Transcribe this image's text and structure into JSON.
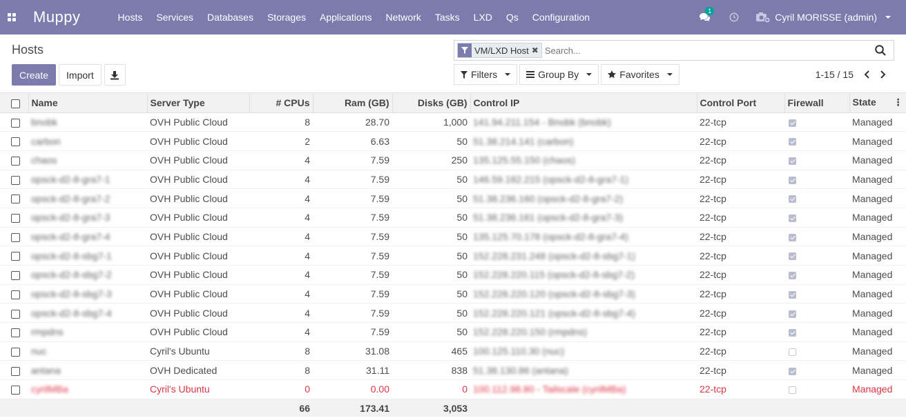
{
  "navbar": {
    "brand": "Muppy",
    "menu": [
      "Hosts",
      "Services",
      "Databases",
      "Storages",
      "Applications",
      "Network",
      "Tasks",
      "LXD",
      "Qs",
      "Configuration"
    ],
    "chat_badge": "1",
    "user": "Cyril MORISSE (admin)"
  },
  "page": {
    "title": "Hosts",
    "create_label": "Create",
    "import_label": "Import"
  },
  "search": {
    "facet": "VM/LXD Host",
    "placeholder": "Search..."
  },
  "filters": {
    "filters_label": "Filters",
    "groupby_label": "Group By",
    "favorites_label": "Favorites"
  },
  "pager": {
    "value": "1-15 / 15"
  },
  "columns": {
    "name": "Name",
    "server_type": "Server Type",
    "cpus": "# CPUs",
    "ram": "Ram (GB)",
    "disks": "Disks (GB)",
    "control_ip": "Control IP",
    "control_port": "Control Port",
    "firewall": "Firewall",
    "state": "State"
  },
  "rows": [
    {
      "name": "bnobk",
      "server_type": "OVH Public Cloud",
      "cpus": "8",
      "ram": "28.70",
      "disks": "1,000",
      "control_ip": "141.94.211.154 - Bnobk (bnobk)",
      "port": "22-tcp",
      "firewall": true,
      "state": "Managed"
    },
    {
      "name": "carbon",
      "server_type": "OVH Public Cloud",
      "cpus": "2",
      "ram": "6.63",
      "disks": "50",
      "control_ip": "51.38.214.141 (carbon)",
      "port": "22-tcp",
      "firewall": true,
      "state": "Managed"
    },
    {
      "name": "chaos",
      "server_type": "OVH Public Cloud",
      "cpus": "4",
      "ram": "7.59",
      "disks": "250",
      "control_ip": "135.125.55.150 (chaos)",
      "port": "22-tcp",
      "firewall": true,
      "state": "Managed"
    },
    {
      "name": "opsck-d2-8-gra7-1",
      "server_type": "OVH Public Cloud",
      "cpus": "4",
      "ram": "7.59",
      "disks": "50",
      "control_ip": "146.59.182.215 (opsck-d2-8-gra7-1)",
      "port": "22-tcp",
      "firewall": true,
      "state": "Managed"
    },
    {
      "name": "opsck-d2-8-gra7-2",
      "server_type": "OVH Public Cloud",
      "cpus": "4",
      "ram": "7.59",
      "disks": "50",
      "control_ip": "51.38.236.160 (opsck-d2-8-gra7-2)",
      "port": "22-tcp",
      "firewall": true,
      "state": "Managed"
    },
    {
      "name": "opsck-d2-8-gra7-3",
      "server_type": "OVH Public Cloud",
      "cpus": "4",
      "ram": "7.59",
      "disks": "50",
      "control_ip": "51.38.236.161 (opsck-d2-8-gra7-3)",
      "port": "22-tcp",
      "firewall": true,
      "state": "Managed"
    },
    {
      "name": "opsck-d2-8-gra7-4",
      "server_type": "OVH Public Cloud",
      "cpus": "4",
      "ram": "7.59",
      "disks": "50",
      "control_ip": "135.125.70.178 (opsck-d2-8-gra7-4)",
      "port": "22-tcp",
      "firewall": true,
      "state": "Managed"
    },
    {
      "name": "opsck-d2-8-sbg7-1",
      "server_type": "OVH Public Cloud",
      "cpus": "4",
      "ram": "7.59",
      "disks": "50",
      "control_ip": "152.228.231.248 (opsck-d2-8-sbg7-1)",
      "port": "22-tcp",
      "firewall": true,
      "state": "Managed"
    },
    {
      "name": "opsck-d2-8-sbg7-2",
      "server_type": "OVH Public Cloud",
      "cpus": "4",
      "ram": "7.59",
      "disks": "50",
      "control_ip": "152.228.220.115 (opsck-d2-8-sbg7-2)",
      "port": "22-tcp",
      "firewall": true,
      "state": "Managed"
    },
    {
      "name": "opsck-d2-8-sbg7-3",
      "server_type": "OVH Public Cloud",
      "cpus": "4",
      "ram": "7.59",
      "disks": "50",
      "control_ip": "152.228.220.120 (opsck-d2-8-sbg7-3)",
      "port": "22-tcp",
      "firewall": true,
      "state": "Managed"
    },
    {
      "name": "opsck-d2-8-sbg7-4",
      "server_type": "OVH Public Cloud",
      "cpus": "4",
      "ram": "7.59",
      "disks": "50",
      "control_ip": "152.228.220.121 (opsck-d2-8-sbg7-4)",
      "port": "22-tcp",
      "firewall": true,
      "state": "Managed"
    },
    {
      "name": "rmpdns",
      "server_type": "OVH Public Cloud",
      "cpus": "4",
      "ram": "7.59",
      "disks": "50",
      "control_ip": "152.228.220.150 (rmpdns)",
      "port": "22-tcp",
      "firewall": true,
      "state": "Managed"
    },
    {
      "name": "nuc",
      "server_type": "Cyril's Ubuntu",
      "cpus": "8",
      "ram": "31.08",
      "disks": "465",
      "control_ip": "100.125.110.30 (nuc)",
      "port": "22-tcp",
      "firewall": false,
      "state": "Managed"
    },
    {
      "name": "antana",
      "server_type": "OVH Dedicated",
      "cpus": "8",
      "ram": "31.11",
      "disks": "838",
      "control_ip": "51.38.130.86 (antana)",
      "port": "22-tcp",
      "firewall": true,
      "state": "Managed"
    },
    {
      "name": "cyrilMBa",
      "server_type": "Cyril's Ubuntu",
      "cpus": "0",
      "ram": "0.00",
      "disks": "0",
      "control_ip": "100.112.98.80 - Tailscale (cyrilMBa)",
      "port": "22-tcp",
      "firewall": false,
      "state": "Managed",
      "error": true
    }
  ],
  "totals": {
    "cpus": "66",
    "ram": "173.41",
    "disks": "3,053"
  },
  "colors": {
    "primary": "#7c7bad",
    "error": "#dc3545",
    "badge": "#00a09d"
  }
}
